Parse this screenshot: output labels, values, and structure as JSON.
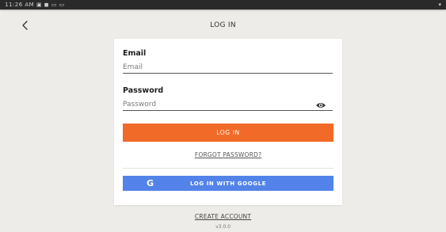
{
  "status_bar": {
    "left_text": "11:26 AM ▣ ◼ ▭ ▭",
    "right_text": "▾"
  },
  "header": {
    "title": "LOG IN",
    "back_icon": "chevron-left-icon"
  },
  "form": {
    "email_label": "Email",
    "email_placeholder": "Email",
    "email_value": "",
    "password_label": "Password",
    "password_placeholder": "Password",
    "password_value": "",
    "password_toggle_icon": "eye-icon",
    "login_label": "LOG IN",
    "forgot_label": "FORGOT PASSWORD?",
    "google_label": "LOG IN WITH GOOGLE",
    "google_icon": "google-g-icon"
  },
  "footer": {
    "create_account_label": "CREATE ACCOUNT",
    "version": "v3.0.0"
  },
  "colors": {
    "background": "#eeece8",
    "login_button": "#f26a28",
    "google_button": "#5383e8",
    "card": "#ffffff"
  }
}
